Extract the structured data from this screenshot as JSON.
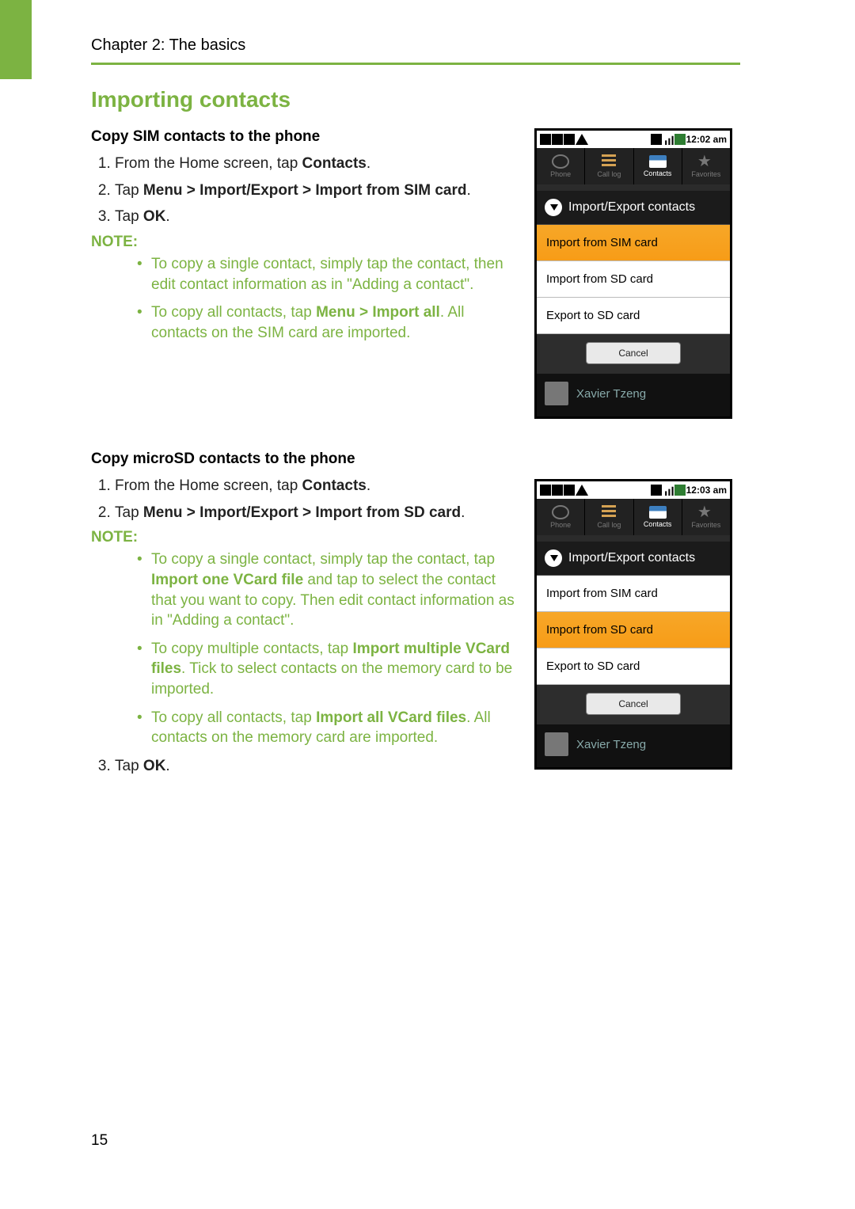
{
  "chapter_header": "Chapter 2: The basics",
  "section_title": "Importing contacts",
  "page_number": "15",
  "sec1": {
    "subhead": "Copy SIM contacts to the phone",
    "step1_pre": "From the Home screen, tap ",
    "step1_b": "Contacts",
    "step1_post": ".",
    "step2_pre": "Tap ",
    "step2_b": "Menu > Import/Export > Import from SIM card",
    "step2_post": ".",
    "step3_pre": "Tap ",
    "step3_b": "OK",
    "step3_post": ".",
    "note_label": "NOTE:",
    "note1": "To copy a single contact, simply tap the contact, then edit contact information as in \"Adding a contact\".",
    "note2_pre": "To copy all contacts, tap ",
    "note2_b": "Menu > Import all",
    "note2_post": ". All contacts on the SIM card are imported."
  },
  "sec2": {
    "subhead": "Copy microSD contacts to the phone",
    "step1_pre": "From the Home screen, tap ",
    "step1_b": "Contacts",
    "step1_post": ".",
    "step2_pre": "Tap ",
    "step2_b": "Menu > Import/Export > Import from SD card",
    "step2_post": ".",
    "note_label": "NOTE:",
    "note1_pre": "To copy a single contact, simply tap the contact, tap ",
    "note1_b": "Import one VCard file",
    "note1_post": " and tap to select the contact that you want to copy. Then edit contact information as in \"Adding a contact\".",
    "note2_pre": "To copy multiple contacts, tap ",
    "note2_b": "Import multiple VCard files",
    "note2_post": ". Tick to select contacts on the memory card to be imported.",
    "note3_pre": "To copy all contacts, tap ",
    "note3_b": "Import all VCard files",
    "note3_post": ". All contacts on the memory card are imported.",
    "step3_pre": "Tap ",
    "step3_b": "OK",
    "step3_post": "."
  },
  "phone_common": {
    "tabs": {
      "phone": "Phone",
      "calllog": "Call log",
      "contacts": "Contacts",
      "favorites": "Favorites"
    },
    "dialog_title": "Import/Export contacts",
    "opt_sim": "Import from SIM card",
    "opt_sd": "Import from SD card",
    "opt_export": "Export to SD card",
    "cancel": "Cancel",
    "contact_name": "Xavier Tzeng"
  },
  "phone1": {
    "time": "12:02 am"
  },
  "phone2": {
    "time": "12:03 am"
  }
}
